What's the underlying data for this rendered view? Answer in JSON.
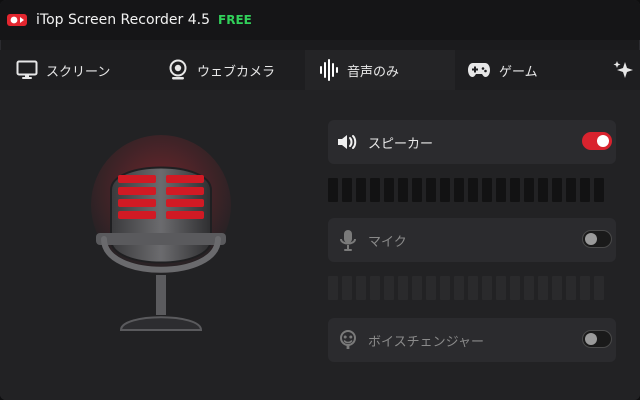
{
  "app": {
    "title": "iTop Screen Recorder 4.5",
    "badge": "FREE",
    "accent": "#d9232e"
  },
  "tabs": [
    {
      "label": "スクリーン",
      "icon": "monitor-icon",
      "active": false
    },
    {
      "label": "ウェブカメラ",
      "icon": "webcam-icon",
      "active": false
    },
    {
      "label": "音声のみ",
      "icon": "audio-waveform-icon",
      "active": true
    },
    {
      "label": "ゲーム",
      "icon": "gamepad-icon",
      "active": false
    },
    {
      "label": "",
      "icon": "sparkle-icon",
      "active": false
    }
  ],
  "audio": {
    "speaker": {
      "label": "スピーカー",
      "icon": "speaker-icon",
      "enabled": true
    },
    "mic": {
      "label": "マイク",
      "icon": "microphone-icon",
      "enabled": false
    },
    "voice_changer": {
      "label": "ボイスチェンジャー",
      "icon": "voice-changer-icon",
      "enabled": false
    }
  }
}
